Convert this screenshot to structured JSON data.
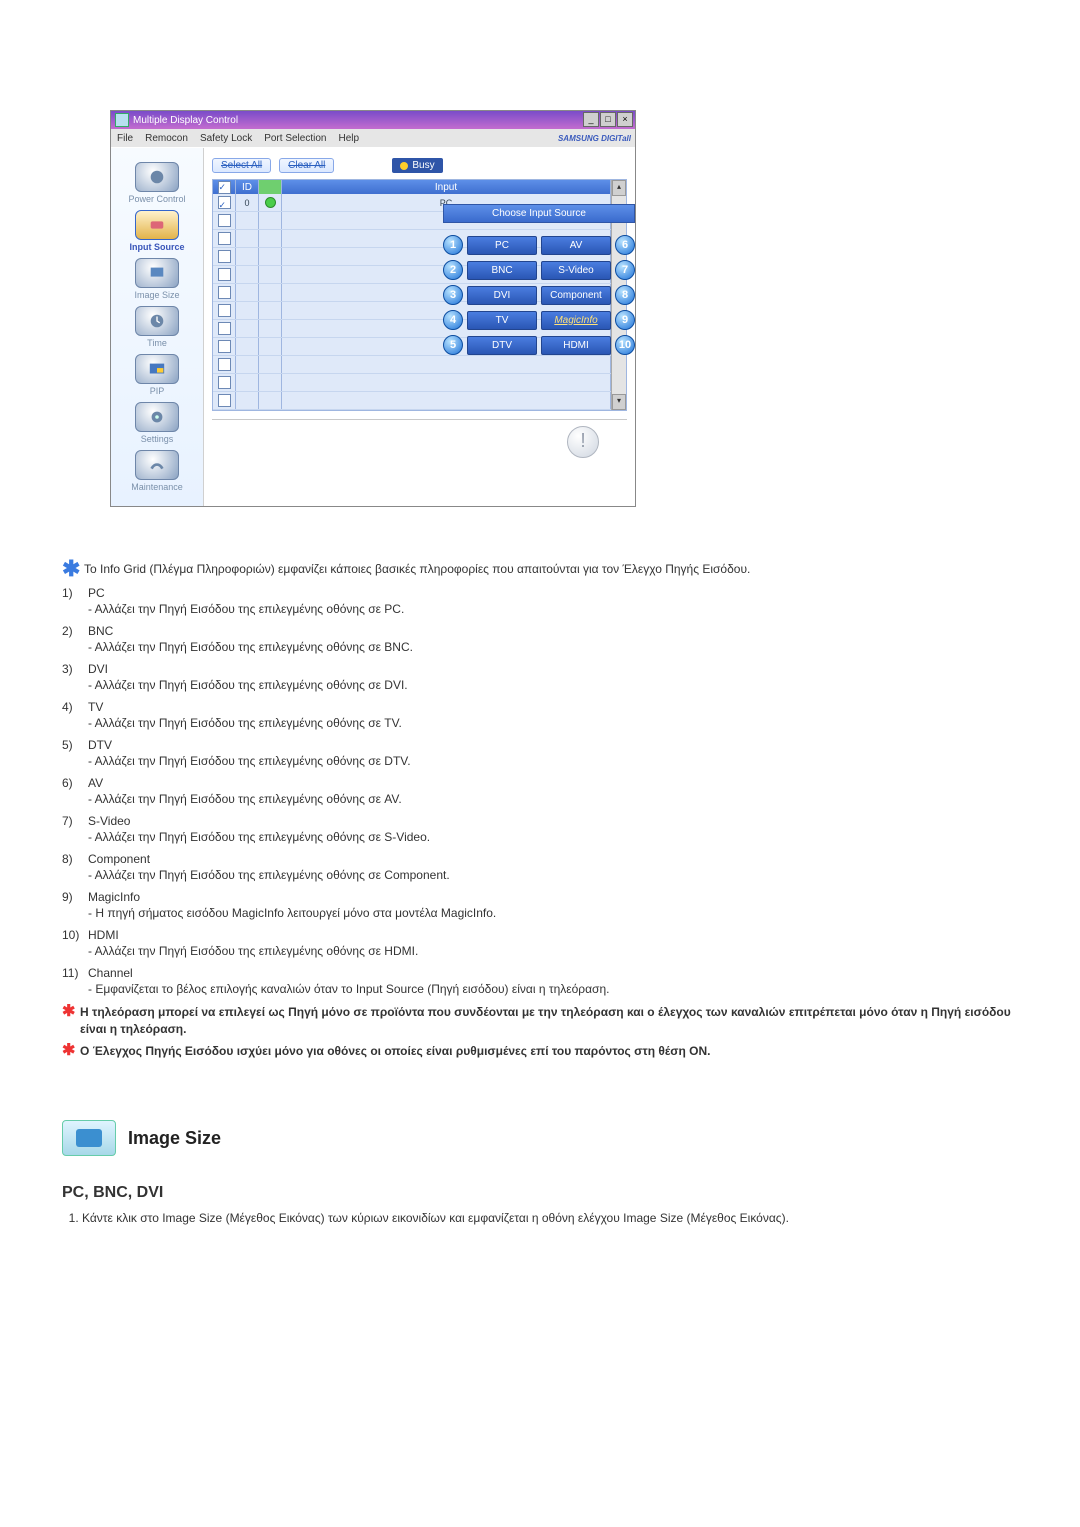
{
  "window": {
    "title": "Multiple Display Control",
    "menu": [
      "File",
      "Remocon",
      "Safety Lock",
      "Port Selection",
      "Help"
    ],
    "brand": "SAMSUNG DIGITall"
  },
  "sidebar": {
    "items": [
      {
        "label": "Power Control"
      },
      {
        "label": "Input Source"
      },
      {
        "label": "Image Size"
      },
      {
        "label": "Time"
      },
      {
        "label": "PIP"
      },
      {
        "label": "Settings"
      },
      {
        "label": "Maintenance"
      }
    ]
  },
  "toolbar": {
    "select_all": "Select All",
    "clear_all": "Clear All",
    "busy": "Busy"
  },
  "grid": {
    "header_id": "ID",
    "header_input": "Input",
    "row0": {
      "id": "0",
      "input": "PC"
    }
  },
  "choose": {
    "title": "Choose Input Source",
    "rows": [
      {
        "n": "1",
        "left": "PC",
        "right": "AV",
        "rn": "6"
      },
      {
        "n": "2",
        "left": "BNC",
        "right": "S-Video",
        "rn": "7"
      },
      {
        "n": "3",
        "left": "DVI",
        "right": "Component",
        "rn": "8"
      },
      {
        "n": "4",
        "left": "TV",
        "right": "MagicInfo",
        "rn": "9"
      },
      {
        "n": "5",
        "left": "DTV",
        "right": "HDMI",
        "rn": "10"
      }
    ]
  },
  "text": {
    "intro": "Το Info Grid (Πλέγμα Πληροφοριών) εμφανίζει κάποιες βασικές πληροφορίες που απαιτούνται για τον Έλεγχο Πηγής Εισόδου.",
    "items": [
      {
        "n": "1)",
        "title": "PC",
        "desc": "- Αλλάζει την Πηγή Εισόδου της επιλεγμένης οθόνης σε PC."
      },
      {
        "n": "2)",
        "title": "BNC",
        "desc": "- Αλλάζει την Πηγή Εισόδου της επιλεγμένης οθόνης σε BNC."
      },
      {
        "n": "3)",
        "title": "DVI",
        "desc": "- Αλλάζει την Πηγή Εισόδου της επιλεγμένης οθόνης σε DVI."
      },
      {
        "n": "4)",
        "title": "TV",
        "desc": "- Αλλάζει την Πηγή Εισόδου της επιλεγμένης οθόνης σε TV."
      },
      {
        "n": "5)",
        "title": "DTV",
        "desc": "- Αλλάζει την Πηγή Εισόδου της επιλεγμένης οθόνης σε DTV."
      },
      {
        "n": "6)",
        "title": "AV",
        "desc": "- Αλλάζει την Πηγή Εισόδου της επιλεγμένης οθόνης σε AV."
      },
      {
        "n": "7)",
        "title": "S-Video",
        "desc": "- Αλλάζει την Πηγή Εισόδου της επιλεγμένης οθόνης σε S-Video."
      },
      {
        "n": "8)",
        "title": "Component",
        "desc": "- Αλλάζει την Πηγή Εισόδου της επιλεγμένης οθόνης σε Component."
      },
      {
        "n": "9)",
        "title": "MagicInfo",
        "desc": "- Η πηγή σήματος εισόδου MagicInfo λειτουργεί μόνο στα μοντέλα MagicInfo."
      },
      {
        "n": "10)",
        "title": "HDMI",
        "desc": "- Αλλάζει την Πηγή Εισόδου της επιλεγμένης οθόνης σε HDMI."
      },
      {
        "n": "11)",
        "title": "Channel",
        "desc": "- Εμφανίζεται το βέλος επιλογής καναλιών όταν το Input Source (Πηγή εισόδου) είναι η τηλεόραση."
      }
    ],
    "note1": "Η τηλεόραση μπορεί να επιλεγεί ως Πηγή μόνο σε προϊόντα που συνδέονται με την τηλεόραση και ο έλεγχος των καναλιών επιτρέπεται μόνο όταν η Πηγή εισόδου είναι η τηλεόραση.",
    "note2": "Ο Έλεγχος Πηγής Εισόδου ισχύει μόνο για οθόνες οι οποίες είναι ρυθμισμένες επί του παρόντος στη θέση ON."
  },
  "section": {
    "title": "Image Size",
    "subtitle": "PC, BNC, DVI",
    "step1": "Κάντε κλικ στο Image Size (Μέγεθος Εικόνας) των κύριων εικονιδίων και εμφανίζεται η οθόνη ελέγχου Image Size (Μέγεθος Εικόνας)."
  }
}
